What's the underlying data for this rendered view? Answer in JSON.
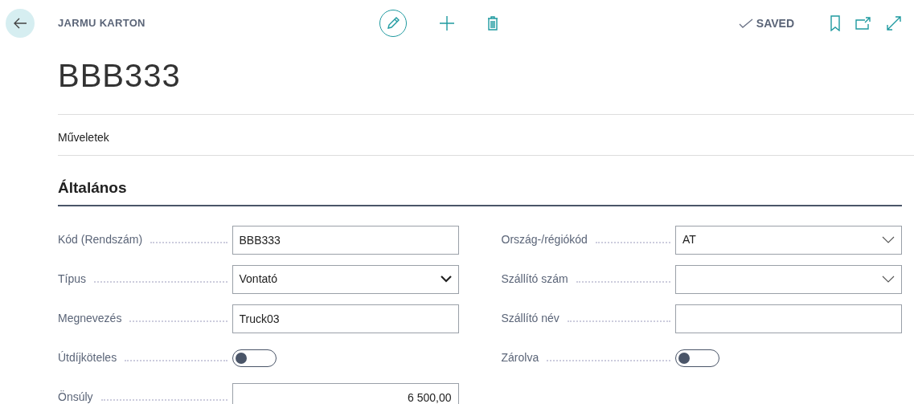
{
  "header": {
    "caption": "JARMU KARTON",
    "title": "BBB333",
    "status": "SAVED"
  },
  "actions_label": "Műveletek",
  "section": {
    "title": "Általános"
  },
  "columns": [
    [
      {
        "kind": "text",
        "label": "Kód (Rendszám)",
        "value": "BBB333"
      },
      {
        "kind": "select",
        "label": "Típus",
        "value": "Vontató"
      },
      {
        "kind": "text",
        "label": "Megnevezés",
        "value": "Truck03"
      },
      {
        "kind": "toggle",
        "label": "Útdíjköteles",
        "on": false
      },
      {
        "kind": "number",
        "label": "Önsúly",
        "value": "6 500,00"
      }
    ],
    [
      {
        "kind": "lookup",
        "label": "Ország-/régiókód",
        "value": "AT"
      },
      {
        "kind": "lookup",
        "label": "Szállító szám"
      },
      {
        "kind": "text",
        "label": "Szállító név"
      },
      {
        "kind": "toggle",
        "label": "Zárolva",
        "on": false
      }
    ]
  ]
}
